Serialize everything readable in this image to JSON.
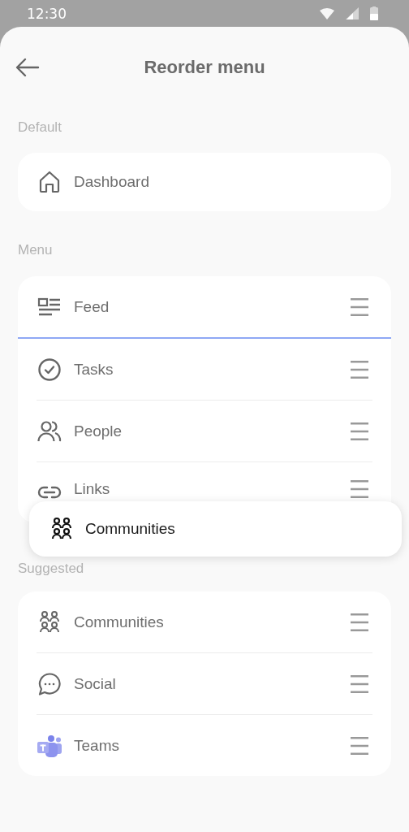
{
  "status_bar": {
    "time": "12:30"
  },
  "header": {
    "title": "Reorder menu"
  },
  "sections": [
    {
      "label": "Default",
      "items": [
        {
          "label": "Dashboard",
          "kind": "home",
          "handle": false,
          "drop_line_below": false
        }
      ]
    },
    {
      "label": "Menu",
      "items": [
        {
          "label": "Feed",
          "kind": "feed",
          "handle": true,
          "drop_line_below": true
        },
        {
          "label": "Tasks",
          "kind": "check-circle",
          "handle": true,
          "drop_line_below": false
        },
        {
          "label": "People",
          "kind": "people",
          "handle": true,
          "drop_line_below": false
        },
        {
          "label": "Links",
          "kind": "link",
          "handle": true,
          "drop_line_below": false
        }
      ]
    },
    {
      "label": "Suggested",
      "items": [
        {
          "label": "Communities",
          "kind": "communities",
          "handle": true,
          "drop_line_below": false
        },
        {
          "label": "Social",
          "kind": "chat",
          "handle": true,
          "drop_line_below": false
        },
        {
          "label": "Teams",
          "kind": "teams",
          "handle": true,
          "drop_line_below": false
        }
      ]
    }
  ],
  "dragged_item": {
    "label": "Communities",
    "kind": "communities"
  }
}
